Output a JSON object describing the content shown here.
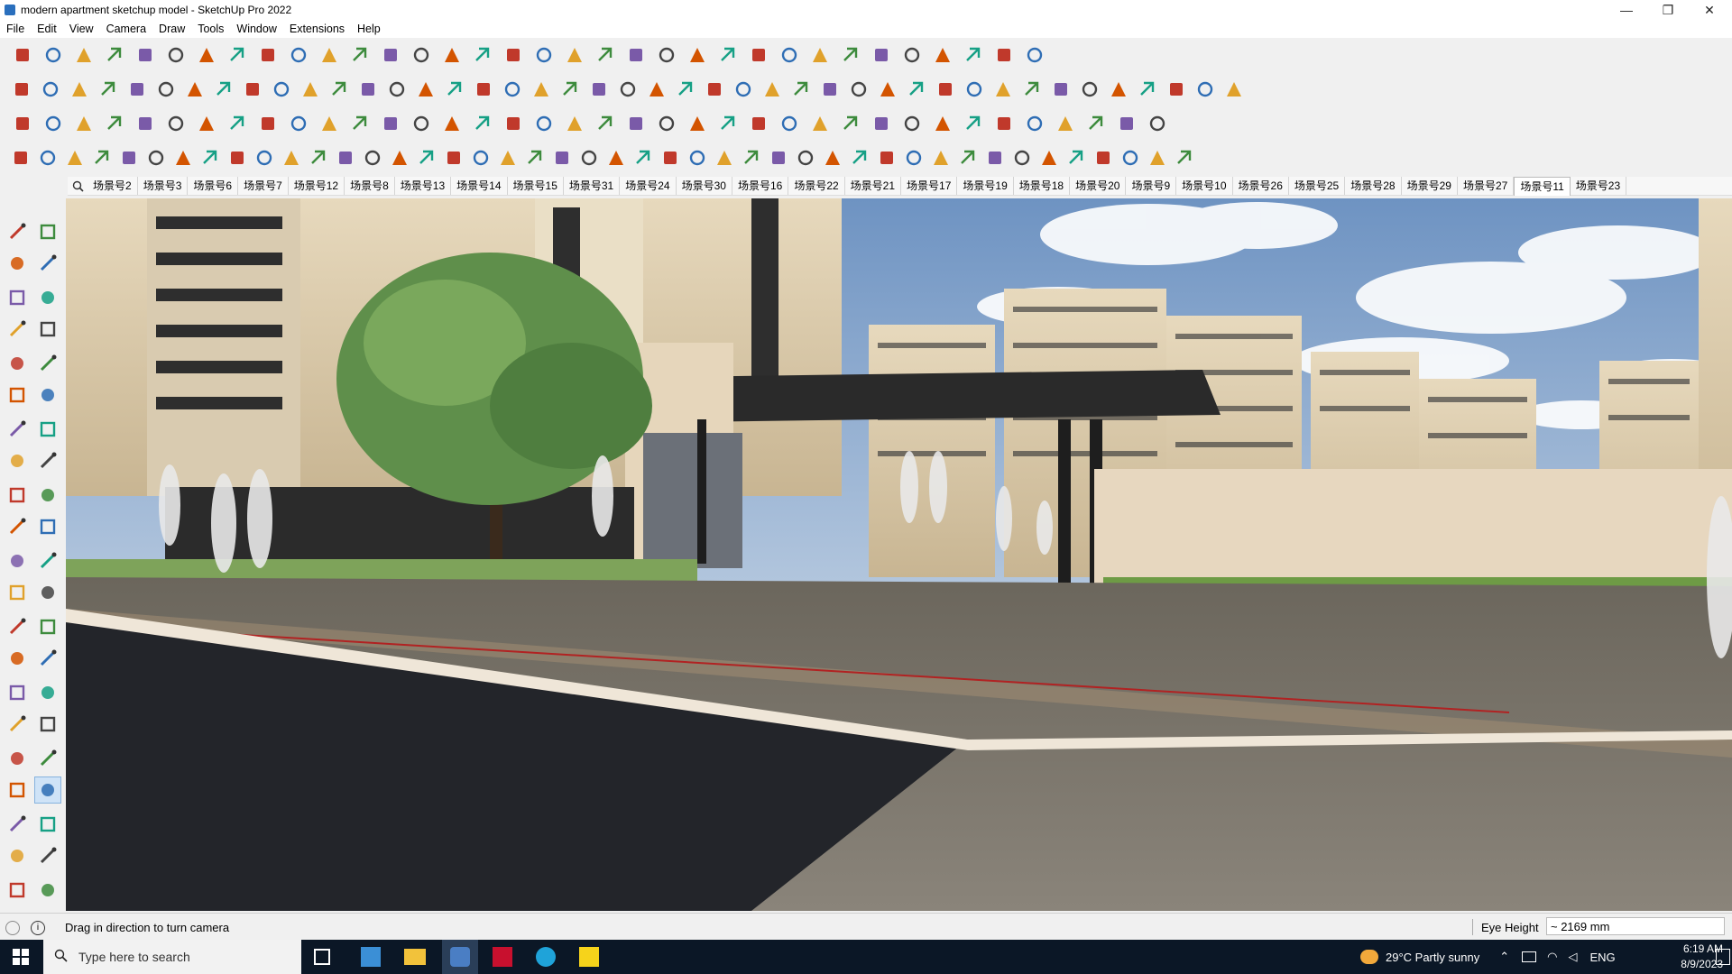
{
  "window": {
    "title": "modern apartment sketchup model - SketchUp Pro 2022",
    "minimize": "—",
    "maximize": "❐",
    "close": "✕"
  },
  "menu": [
    "File",
    "Edit",
    "View",
    "Camera",
    "Draw",
    "Tools",
    "Window",
    "Extensions",
    "Help"
  ],
  "scenes": {
    "active": "场景号11",
    "tabs": [
      "场景号2",
      "场景号3",
      "场景号6",
      "场景号7",
      "场景号12",
      "场景号8",
      "场景号13",
      "场景号14",
      "场景号15",
      "场景号31",
      "场景号24",
      "场景号30",
      "场景号16",
      "场景号22",
      "场景号21",
      "场景号17",
      "场景号19",
      "场景号18",
      "场景号20",
      "场景号9",
      "场景号10",
      "场景号26",
      "场景号25",
      "场景号28",
      "场景号29",
      "场景号27",
      "场景号11",
      "场景号23"
    ]
  },
  "toolbars": {
    "row1": [
      "zoom-extents-icon",
      "select-icon",
      "eraser-icon",
      "line-icon",
      "arc-icon",
      "rectangle-icon",
      "push-pull-icon",
      "follow-me-icon",
      "move-icon",
      "rotate-icon",
      "scale-icon",
      "tape-icon",
      "text-icon",
      "paint-icon",
      "orbit-icon",
      "pan-icon",
      "zoom-icon",
      "zoom-window-icon",
      "component-icon",
      "styles-icon",
      "layers-icon",
      "shadows-icon",
      "account-icon",
      "warehouse-icon",
      "extension-warehouse-icon",
      "ruby-icon",
      "sandbox-smoove-icon",
      "sandbox-stamp-icon",
      "sandbox-drape-icon",
      "sandbox-detail-icon",
      "sandbox-flip-icon",
      "undo-icon",
      "redo-icon",
      "section-icon"
    ],
    "row2": [
      "box-iso-icon",
      "box-top-icon",
      "box-front-icon",
      "solid-union-icon",
      "solid-subtract-icon",
      "solid-intersect-icon",
      "solid-trim-icon",
      "solid-split-icon",
      "solid-outer-icon",
      "solid-shell-icon",
      "solid-merge-icon",
      "curve-icon",
      "section-plane-icon",
      "section-cut-icon",
      "section-fill-icon",
      "sandbox-contours-icon",
      "sandbox-scratch-icon",
      "house-icon",
      "house-front-icon",
      "house-side-icon",
      "house-back-icon",
      "house-roof-icon",
      "function-icon",
      "tag-icon",
      "pencil-icon",
      "shape-1-icon",
      "shape-2-icon",
      "shape-3-icon",
      "shape-4-icon",
      "shape-5-icon",
      "shape-6-icon",
      "shape-7-icon",
      "shape-8-icon",
      "shape-9-icon",
      "shape-10-icon",
      "shape-11-icon",
      "shape-12-icon",
      "shape-13-icon",
      "shape-14-icon",
      "shape-15-icon",
      "shape-16-icon",
      "shape-17-icon",
      "shape-18-icon"
    ],
    "row3": [
      "tile-blue-icon",
      "tile-blue2-icon",
      "tile-yellow-icon",
      "tile-green-icon",
      "tile-red-icon",
      "tile-grey-icon",
      "arc-orange-icon",
      "square-red-icon",
      "grid-icon",
      "page-icon",
      "cube-icon",
      "chain-icon",
      "stair-icon",
      "nodes-icon",
      "cross-plus-icon",
      "cross-x-icon",
      "cone-icon",
      "triangle-icon",
      "ring-icon",
      "ring2-icon",
      "ring3-icon",
      "crosshair-icon",
      "box-brown-icon",
      "magnet-icon",
      "tree-icon",
      "puzzle-icon",
      "puzzle2-icon",
      "puzzle3-icon",
      "cube2-icon",
      "gem-icon",
      "mesh-icon",
      "frame-icon",
      "grid-orange-icon",
      "grid-orange2-icon",
      "grid-orange3-icon",
      "close-red-icon",
      "lasso-icon",
      "qr-icon"
    ],
    "row4": [
      "tool-1-icon",
      "tool-2-icon",
      "tool-3-icon",
      "tool-4-icon",
      "tool-5-icon",
      "tool-6-icon",
      "tool-7-icon",
      "tool-8-icon",
      "tool-9-icon",
      "tool-10-icon",
      "tool-11-icon",
      "tool-12-icon",
      "tool-13-icon",
      "tool-14-icon",
      "tool-15-icon",
      "tool-16-icon",
      "tool-17-icon",
      "tool-18-icon",
      "tool-19-icon",
      "tool-20-icon",
      "tool-21-icon",
      "tool-22-icon",
      "tool-23-icon",
      "tool-24-icon",
      "tool-25-icon",
      "tool-26-icon",
      "tool-27-icon",
      "tool-28-icon",
      "tool-29-icon",
      "tool-30-icon",
      "tool-31-icon",
      "tool-32-icon",
      "tool-33-icon",
      "tool-34-icon",
      "tool-35-icon",
      "tool-36-icon",
      "tool-37-icon",
      "tool-38-icon",
      "tool-39-icon",
      "tool-40-icon",
      "tool-41-icon",
      "tool-42-icon",
      "tool-43-icon",
      "tool-44-icon"
    ]
  },
  "left_tools": [
    "select-icon",
    "orbit-icon",
    "paint-icon",
    "eraser-icon",
    "component-icon",
    "pencil-icon",
    "line-icon",
    "freehand-icon",
    "rectangle-icon",
    "rotated-rectangle-icon",
    "circle-icon",
    "polygon-icon",
    "arc-icon",
    "two-point-arc-icon",
    "pie-icon",
    "three-point-arc-icon",
    "move-icon",
    "push-pull-icon",
    "rotate-icon",
    "follow-me-icon",
    "scale-icon",
    "offset-icon",
    "tape-icon",
    "dimension-icon",
    "protractor-icon",
    "text-icon",
    "axes-icon",
    "3d-text-icon",
    "orbit-tool-icon",
    "pan-icon",
    "zoom-icon",
    "zoom-window-icon",
    "zoom-extents-icon",
    "previous-icon",
    "position-camera-icon",
    "look-around-icon",
    "walk-icon",
    "section-plane-icon",
    "component-browser-icon",
    "styles-icon",
    "layers-icon",
    "shadows-icon"
  ],
  "status": {
    "message": "Drag in direction to turn camera",
    "measure_label": "Eye Height",
    "measure_value": "~ 2169 mm"
  },
  "taskbar": {
    "search_placeholder": "Type here to search",
    "weather": "29°C  Partly sunny",
    "lang": "ENG",
    "time": "6:19 AM",
    "date": "8/9/2023"
  }
}
